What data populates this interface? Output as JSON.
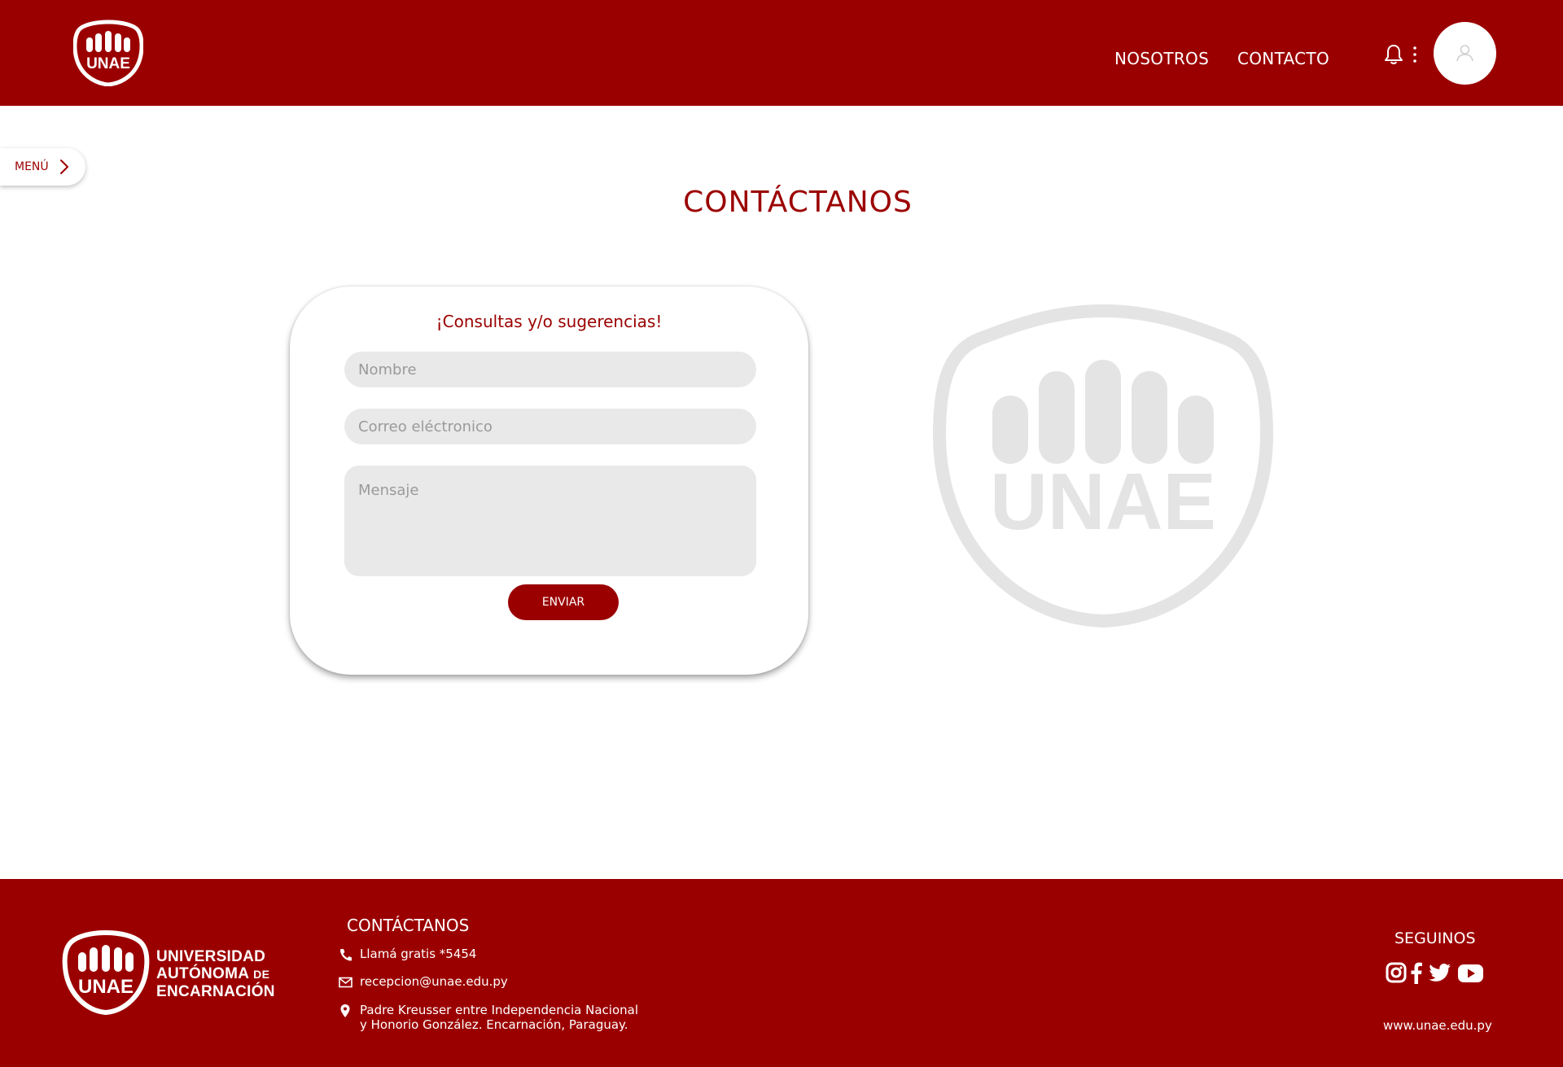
{
  "header": {
    "logo_text": "UNAE",
    "nav": [
      {
        "label": "NOSOTROS"
      },
      {
        "label": "CONTACTO"
      }
    ],
    "icons": [
      "bell-icon",
      "kebab-menu-icon",
      "user-avatar-icon"
    ]
  },
  "menu": {
    "label": "MENÚ",
    "icon": "chevron-right-icon"
  },
  "page": {
    "title": "CONTÁCTANOS"
  },
  "form": {
    "title": "¡Consultas y/o sugerencias!",
    "name_placeholder": "Nombre",
    "email_placeholder": "Correo eléctronico",
    "message_placeholder": "Mensaje",
    "submit_label": "ENVIAR"
  },
  "watermark": {
    "text": "UNAE"
  },
  "footer": {
    "logo_text": "UNAE",
    "university_lines": [
      "UNIVERSIDAD",
      "AUTÓNOMA",
      "DE",
      "ENCARNACIÓN"
    ],
    "contact_title": "CONTÁCTANOS",
    "phone": "Llamá gratis *5454",
    "email": "recepcion@unae.edu.py",
    "address_line1": "Padre Kreusser entre Independencia Nacional",
    "address_line2": "y Honorio González. Encarnación, Paraguay.",
    "follow_title": "SEGUINOS",
    "social_icons": [
      "instagram-icon",
      "facebook-icon",
      "twitter-icon",
      "youtube-icon"
    ],
    "website": "www.unae.edu.py"
  },
  "colors": {
    "brand": "#9b0000",
    "field_bg": "#e9e9e9",
    "watermark": "#e4e4e4"
  }
}
